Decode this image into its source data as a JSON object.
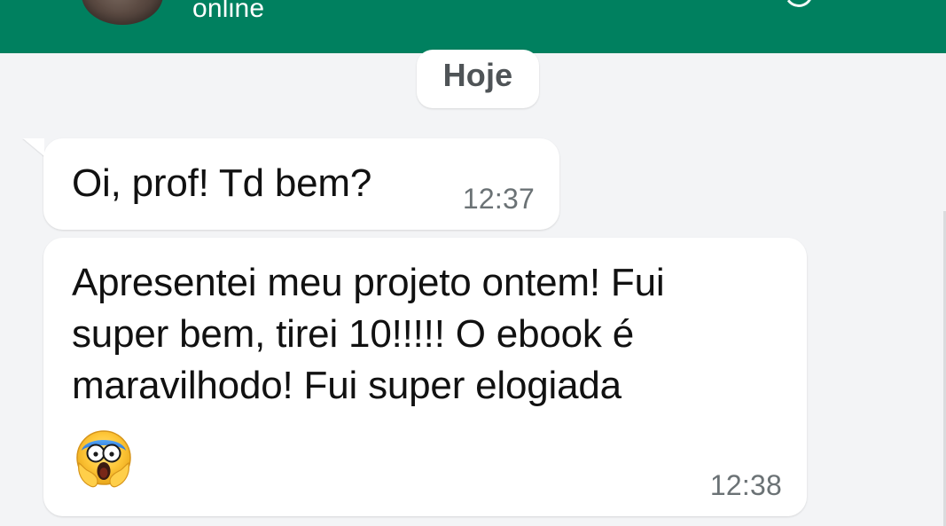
{
  "header": {
    "status": "online",
    "background": "#00805f"
  },
  "chat": {
    "date_chip": "Hoje",
    "messages": [
      {
        "text": "Oi, prof! Td bem?",
        "time": "12:37"
      },
      {
        "text": "Apresentei meu projeto ontem! Fui\nsuper bem, tirei 10!!!!! O ebook é\nmaravilhodo! Fui super elogiada",
        "emoji": "screaming-face-emoji",
        "time": "12:38"
      }
    ]
  }
}
